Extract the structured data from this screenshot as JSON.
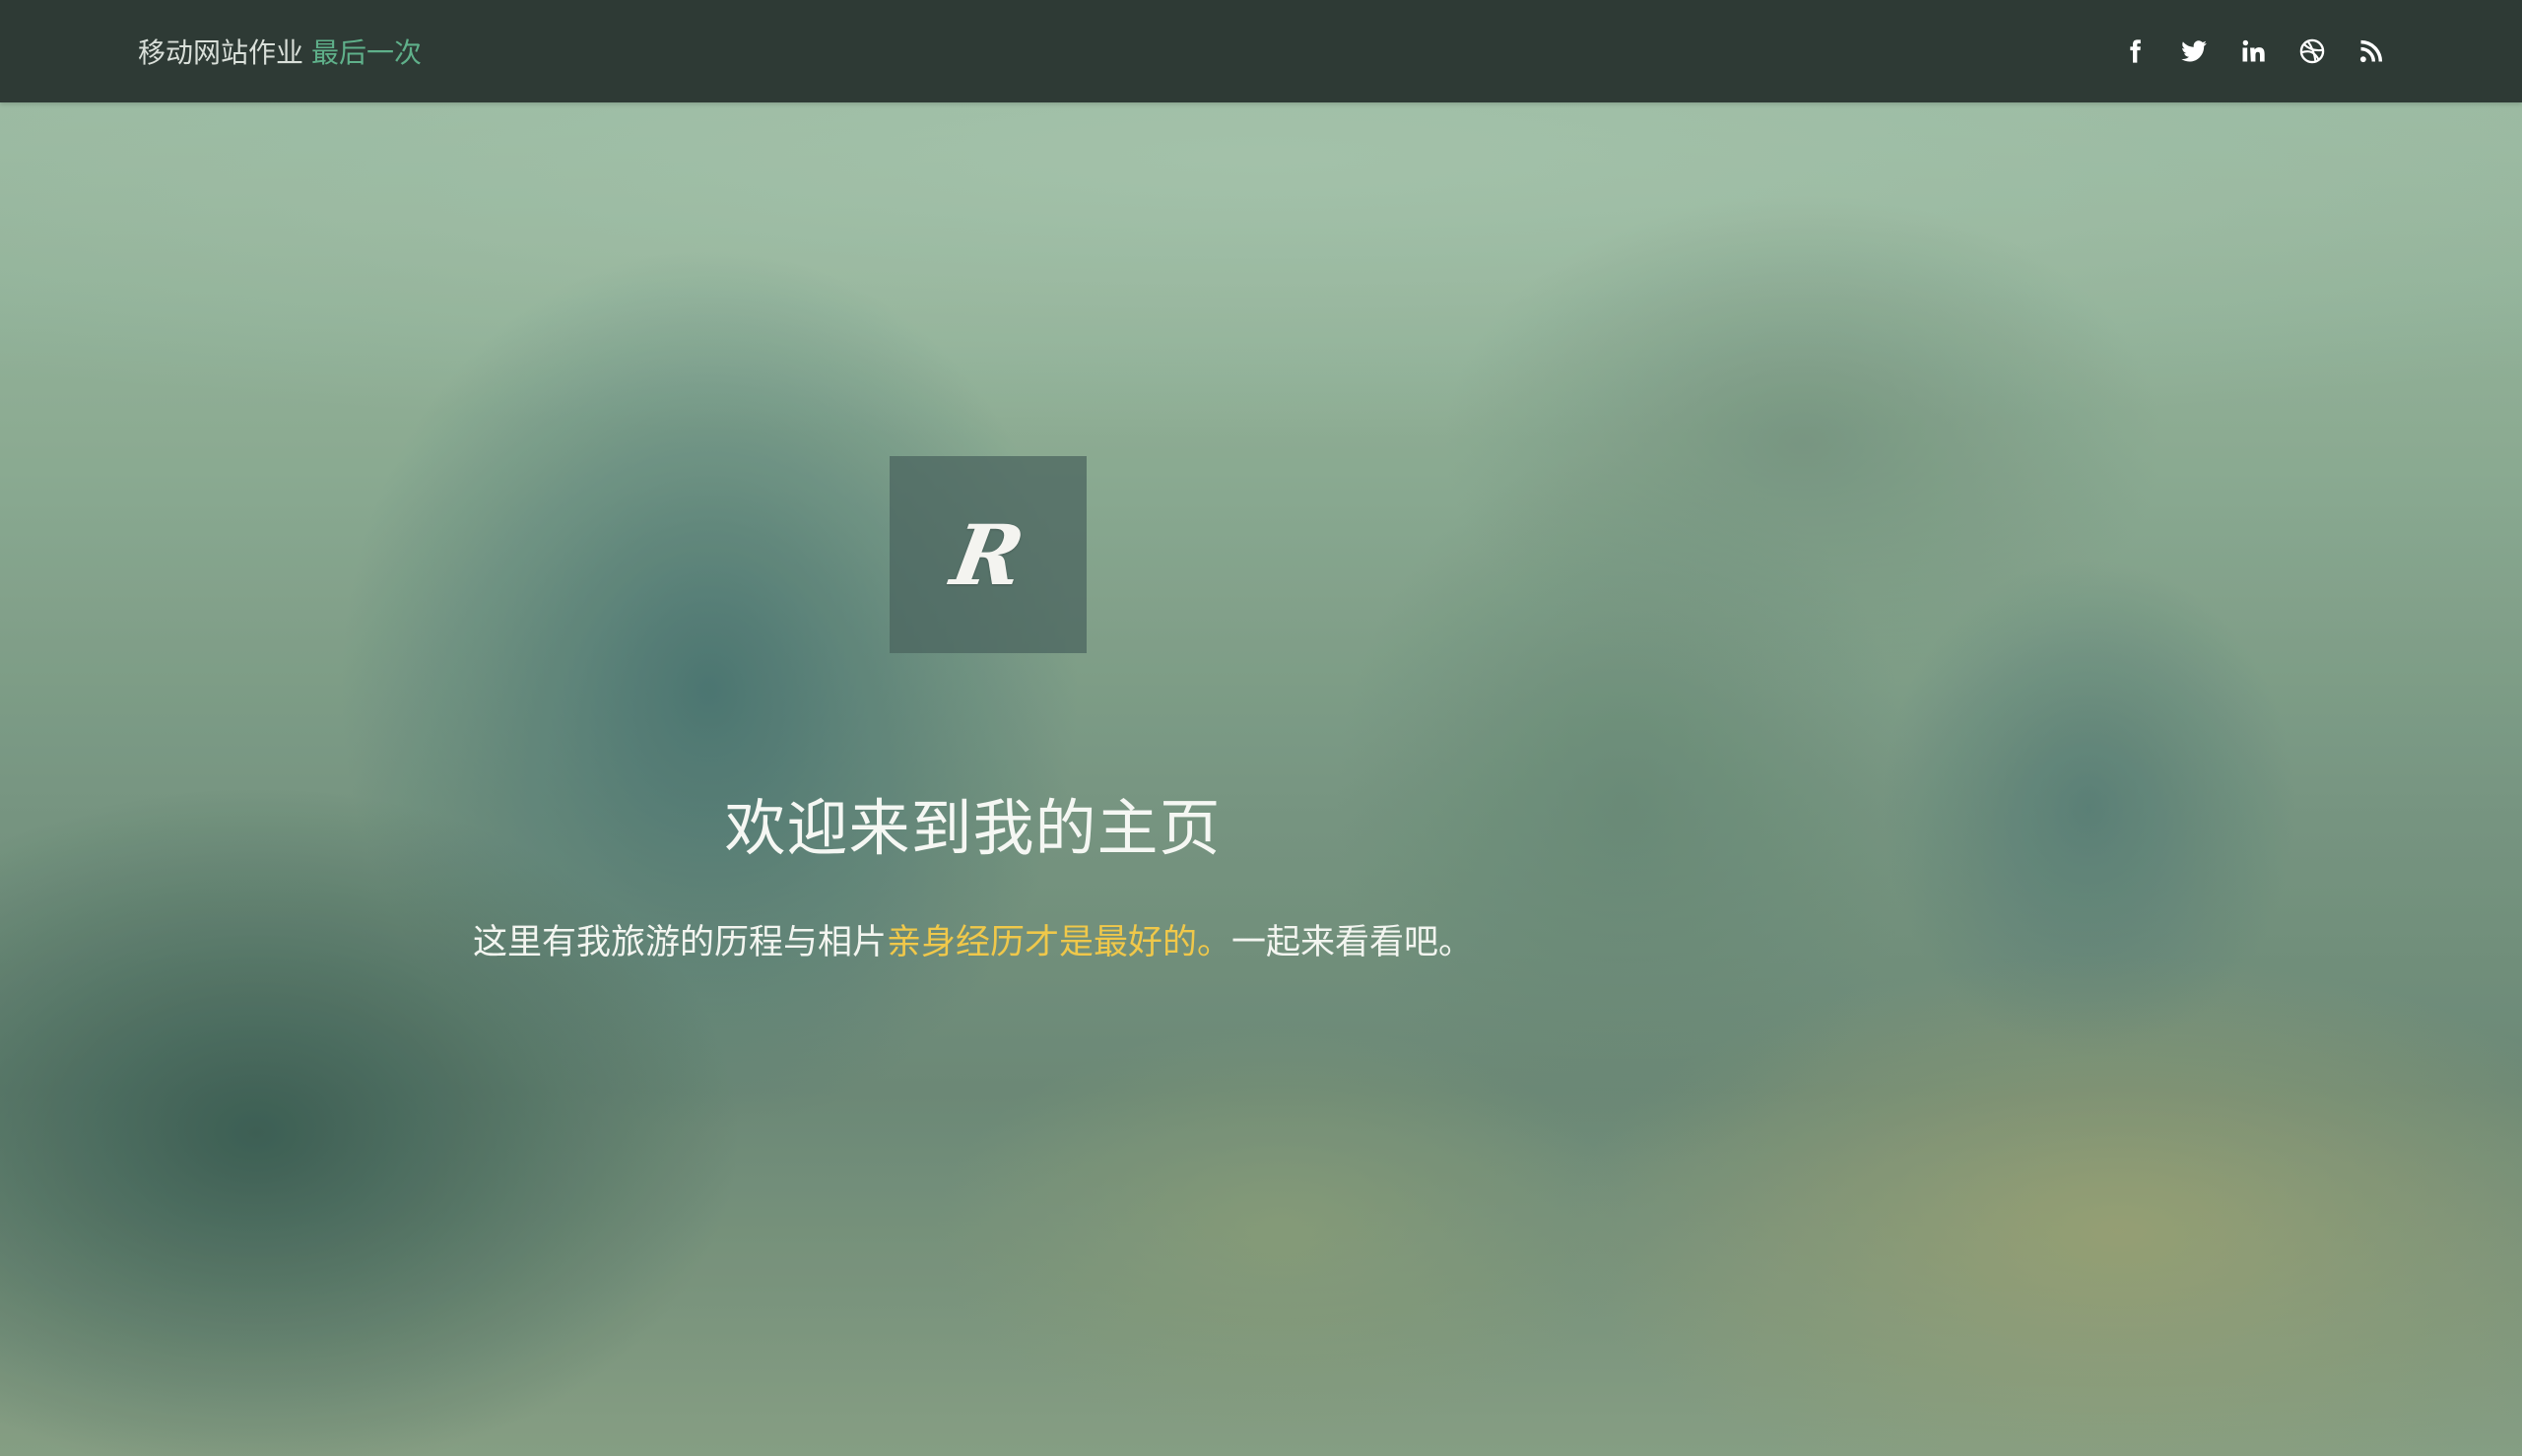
{
  "brand": {
    "main": "移动网站作业",
    "accent": "最后一次"
  },
  "social": [
    {
      "icon": "facebook-icon"
    },
    {
      "icon": "twitter-icon"
    },
    {
      "icon": "linkedin-icon"
    },
    {
      "icon": "dribbble-icon"
    },
    {
      "icon": "rss-icon"
    }
  ],
  "hero": {
    "logo_letter": "R",
    "title": "欢迎来到我的主页",
    "subtitle_part1": "这里有我旅游的历程与相片",
    "subtitle_highlight": "亲身经历才是最好的。",
    "subtitle_part2": "一起来看看吧。"
  },
  "colors": {
    "navbar_bg": "#2e3a35",
    "brand_accent": "#5fb08a",
    "highlight": "#f0c84a"
  }
}
